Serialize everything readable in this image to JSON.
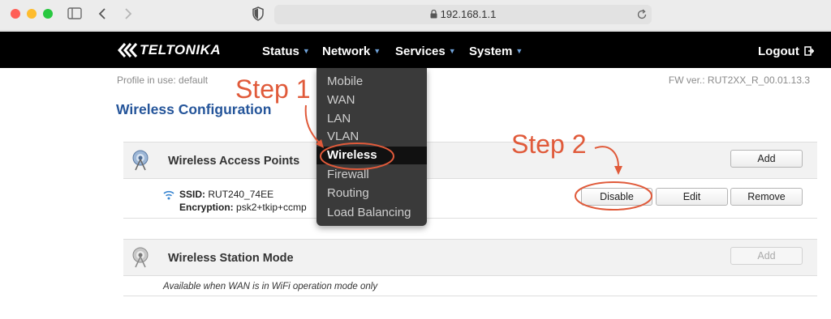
{
  "browser": {
    "url": "192.168.1.1",
    "colors": {
      "close": "#ff5f57",
      "minimize": "#febc2e",
      "maximize": "#28c840"
    }
  },
  "nav": {
    "brand": "TELTONIKA",
    "items": [
      "Status",
      "Network",
      "Services",
      "System"
    ],
    "logout": "Logout"
  },
  "header": {
    "profile": "Profile in use: default",
    "fw": "FW ver.: RUT2XX_R_00.01.13.3"
  },
  "page_title": "Wireless Configuration",
  "access_points": {
    "title": "Wireless Access Points",
    "add": "Add",
    "ssid_label": "SSID:",
    "ssid_value": "RUT240_74EE",
    "enc_label": "Encryption:",
    "enc_value": "psk2+tkip+ccmp",
    "disable": "Disable",
    "edit": "Edit",
    "remove": "Remove"
  },
  "station": {
    "title": "Wireless Station Mode",
    "add": "Add",
    "note": "Available when WAN is in WiFi operation mode only"
  },
  "dropdown": {
    "items": [
      "Mobile",
      "WAN",
      "LAN",
      "VLAN",
      "Wireless",
      "Firewall",
      "Routing",
      "Load Balancing"
    ],
    "selected": "Wireless"
  },
  "annotations": {
    "step1": "Step 1",
    "step2": "Step 2",
    "color": "#e05a3a"
  }
}
